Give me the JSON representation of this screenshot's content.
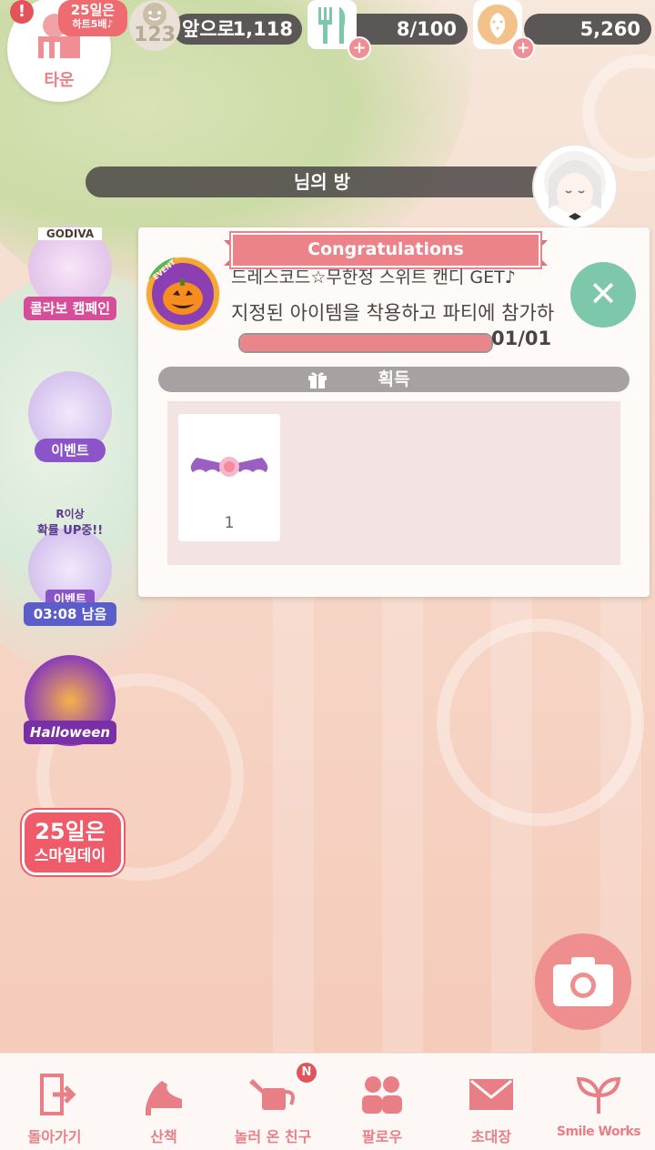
{
  "topbar": {
    "town_label": "타운",
    "alert_icon": "!",
    "bonus": {
      "line1": "25일은",
      "line2": "하트5배♪"
    },
    "smile_level": "123",
    "hearts": {
      "label_prefix": "앞으로",
      "value": "1,118"
    },
    "food": {
      "value": "8/100"
    },
    "strawberry": {
      "value": "5,260"
    }
  },
  "room": {
    "title": "님의 방"
  },
  "side_icons": [
    {
      "top": "GODIVA",
      "tag": "콜라보 캠페인"
    },
    {
      "tag": "이벤트"
    },
    {
      "top1": "R이상",
      "top2": "확률 UP중!!",
      "tag1": "이벤트",
      "tag2": "03:08 남음"
    },
    {
      "tag": "Halloween"
    },
    {
      "line1": "25일은",
      "line2": "스마일데이"
    }
  ],
  "popup": {
    "ribbon": "Congratulations",
    "event_badge": "EVENT",
    "title": "드레스코드☆무한정 스위트 캔디 GET♪",
    "description": "지정된 아이템을 착용하고 파티에 참가하",
    "progress_text": "01/01",
    "progress_ratio": 1.0,
    "reward_label": "획득",
    "rewards": [
      {
        "count": "1"
      }
    ]
  },
  "bottom_nav": [
    {
      "label": "돌아가기"
    },
    {
      "label": "산책"
    },
    {
      "label": "놀러 온 친구",
      "badge": "N"
    },
    {
      "label": "팔로우"
    },
    {
      "label": "초대장"
    },
    {
      "label": "Smile Works"
    }
  ],
  "colors": {
    "accent": "#ec8389",
    "mint": "#7dc7aa",
    "bar": "#5b5757"
  }
}
